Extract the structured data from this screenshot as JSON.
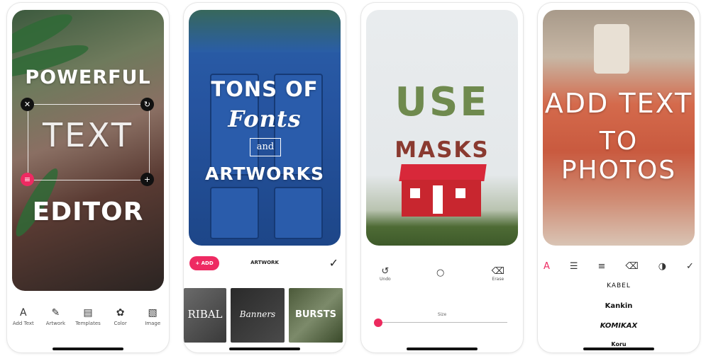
{
  "panel1": {
    "headline_top": "POWERFUL",
    "headline_mid": "TEXT",
    "headline_bottom": "EDITOR",
    "toolbar": [
      {
        "label": "Add Text",
        "icon": "text-a-icon"
      },
      {
        "label": "Artwork",
        "icon": "pencil-icon"
      },
      {
        "label": "Templates",
        "icon": "templates-icon"
      },
      {
        "label": "Color",
        "icon": "color-wheel-icon"
      },
      {
        "label": "Image",
        "icon": "image-icon"
      }
    ]
  },
  "panel2": {
    "line1": "TONS OF",
    "line2": "Fonts",
    "line3": "and",
    "line4": "ARTWORKS",
    "add_label": "+ ADD",
    "section_label": "ARTWORK",
    "thumbnails": [
      "RIBAL",
      "Banners",
      "BURSTS"
    ]
  },
  "panel3": {
    "line1": "USE",
    "line2": "MASKS",
    "undo_label": "Undo",
    "erase_label": "Erase",
    "size_label": "Size"
  },
  "panel4": {
    "line1": "ADD TEXT",
    "line2": "TO PHOTOS",
    "fonts": [
      "KABEL",
      "Kankin",
      "KOMIKAX",
      "Koru"
    ]
  },
  "colors": {
    "accent": "#ee2a62"
  }
}
